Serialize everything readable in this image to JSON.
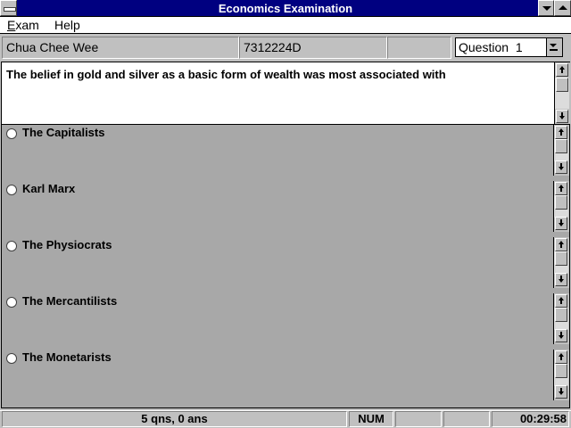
{
  "window": {
    "title": "Economics Examination"
  },
  "menu": {
    "exam_underline": "E",
    "exam_rest": "xam",
    "help": "Help"
  },
  "candidate": {
    "name": "Chua Chee Wee",
    "id": "7312224D"
  },
  "question_select": {
    "selected": "Question  1"
  },
  "question": {
    "text": "The belief in gold and silver as a basic form of wealth was most associated with"
  },
  "answers": [
    {
      "label": "The Capitalists",
      "selected": false
    },
    {
      "label": "Karl Marx",
      "selected": false
    },
    {
      "label": "The Physiocrats",
      "selected": false
    },
    {
      "label": "The Mercantilists",
      "selected": false
    },
    {
      "label": "The Monetarists",
      "selected": false
    }
  ],
  "status": {
    "summary": "5 qns, 0 ans",
    "num": "NUM",
    "timer": "00:29:58"
  },
  "colors": {
    "title_bar": "#000080",
    "face": "#c0c0c0",
    "answers_bg": "#a8a8a8"
  },
  "icons": [
    "system-menu-icon",
    "minimize-icon",
    "maximize-icon",
    "dropdown-arrow-icon",
    "scroll-up-icon",
    "scroll-down-icon",
    "radio-icon"
  ]
}
